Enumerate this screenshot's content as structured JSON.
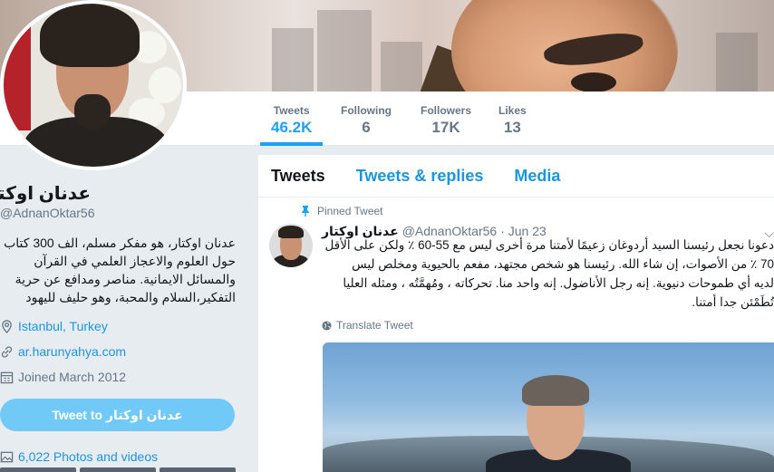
{
  "profile": {
    "name": "عدنان اوكتار",
    "handle": "@AdnanOktar56",
    "bio": "عدنان اوكتار، هو مفكر مسلم، الف 300 كتاب حول العلوم والاعجاز العلمي في القرآن والمسائل الايمانية. مناصر ومدافع عن حرية التفكير،السلام والمحبة، وهو حليف لليهود",
    "location": "Istanbul, Turkey",
    "website": "ar.harunyahya.com",
    "joined": "Joined March 2012",
    "tweet_to_button": "Tweet to عدنان اوكتار",
    "photos_label": "6,022 Photos and videos"
  },
  "stats": [
    {
      "label": "Tweets",
      "value": "46.2K"
    },
    {
      "label": "Following",
      "value": "6"
    },
    {
      "label": "Followers",
      "value": "17K"
    },
    {
      "label": "Likes",
      "value": "13"
    }
  ],
  "timeline": {
    "tabs": [
      "Tweets",
      "Tweets & replies",
      "Media"
    ],
    "active_tab": "Tweets"
  },
  "tweet": {
    "pinned_label": "Pinned Tweet",
    "name": "عدنان اوكتار",
    "handle": "@AdnanOktar56",
    "date": "· Jun 23",
    "lines": [
      "دعونا نجعل رئيسنا السيد أردوغان زعيمًا لأمتنا مرة أخرى ليس مع 55-60 ٪ ولكن على الأقل",
      "70 ٪ من الأصوات، إن شاء الله. رئيسنا هو شخص مجتهد، مفعم بالحيوية ومخلص ليس",
      "لديه أي طموحات دنيوية. إنه رجل الأناضول. إنه واحد منا. تحركاته ، ومُهمَّتُه ، ومثله العليا",
      "تُطَمْئن جدا أمتنا."
    ],
    "translate_label": "Translate Tweet"
  },
  "colors": {
    "accent": "#1da1f2",
    "link": "#1b95e0",
    "button": "#71c9f8",
    "muted": "#657786"
  }
}
